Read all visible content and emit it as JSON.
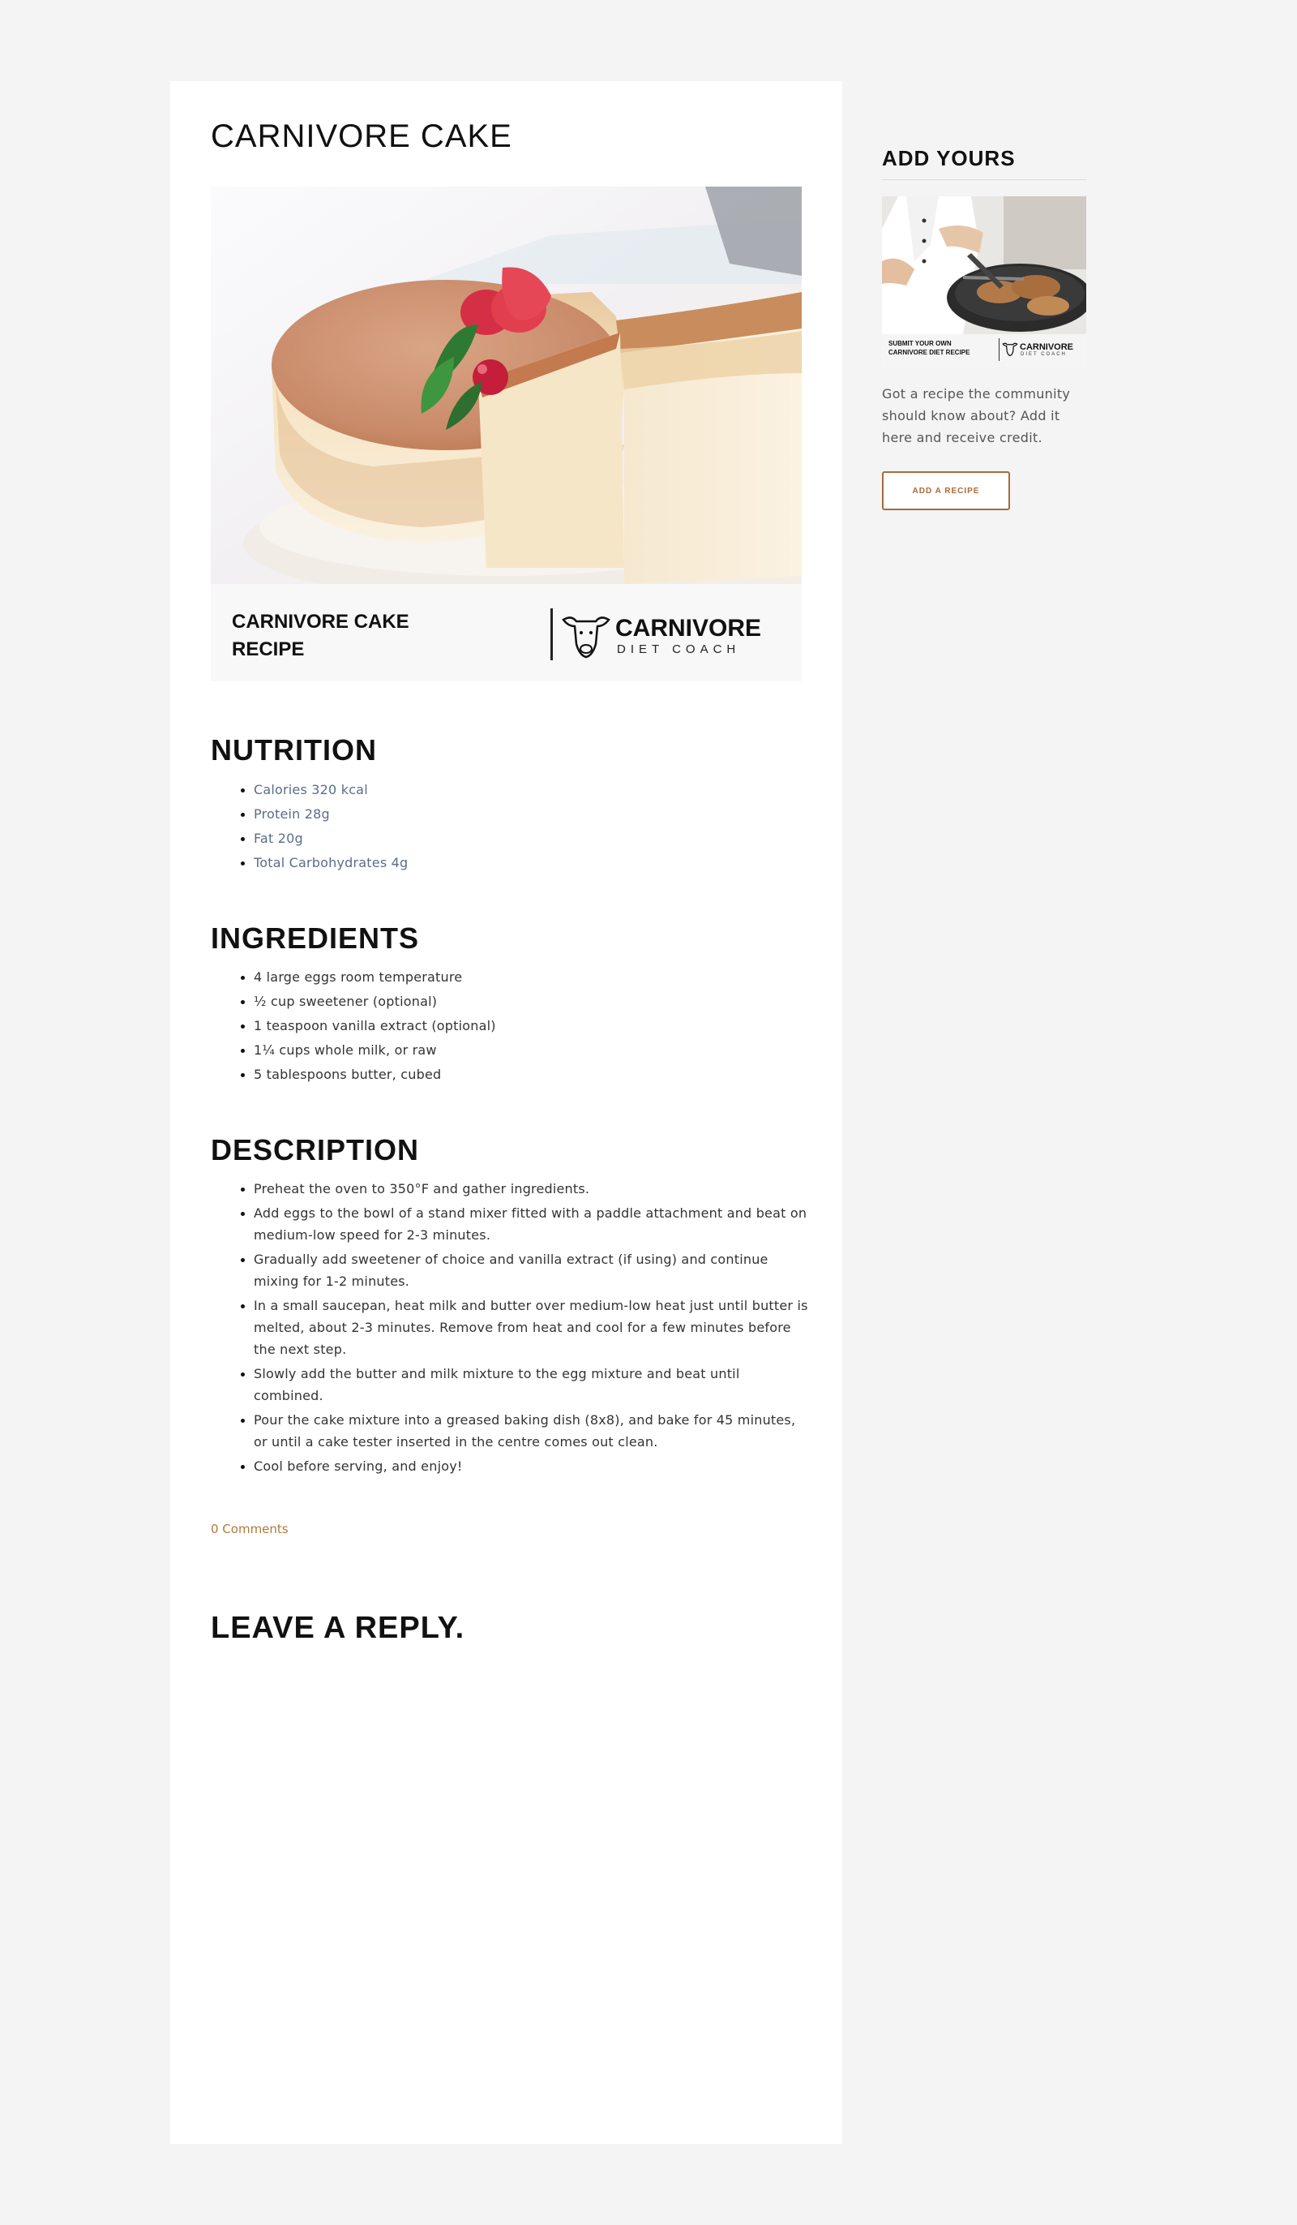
{
  "post": {
    "title": "CARNIVORE CAKE",
    "hero": {
      "caption": "CARNIVORE CAKE RECIPE",
      "brand_main": "CARNIVORE",
      "brand_sub": "DIET COACH"
    }
  },
  "nutrition": {
    "heading": "NUTRITION",
    "items": [
      "Calories 320 kcal",
      "Protein 28g",
      "Fat 20g",
      "Total Carbohydrates 4g"
    ]
  },
  "ingredients": {
    "heading": "INGREDIENTS",
    "items": [
      "4 large eggs room temperature",
      "½ cup sweetener (optional)",
      "1 teaspoon vanilla extract (optional)",
      "1¼ cups whole milk, or raw",
      "5 tablespoons butter, cubed"
    ]
  },
  "description": {
    "heading": "DESCRIPTION",
    "items": [
      "Preheat the oven to 350°F and gather ingredients.",
      "Add eggs to the bowl of a stand mixer fitted with a paddle attachment and beat on medium-low speed for 2-3 minutes.",
      "Gradually add sweetener of choice and vanilla extract (if using) and continue mixing for 1-2 minutes.",
      "In a small saucepan, heat milk and butter over medium-low heat just until butter is melted, about 2-3 minutes. Remove from heat and cool for a few minutes before the next step.",
      "Slowly add the butter and milk mixture to the egg mixture and beat until combined.",
      "Pour the cake mixture into a greased baking dish (8x8), and bake for 45 minutes, or until a cake tester inserted in the centre comes out clean.",
      "Cool before serving, and enjoy!"
    ]
  },
  "comments": {
    "link": "0 Comments"
  },
  "reply": {
    "heading": "LEAVE A REPLY."
  },
  "sidebar": {
    "heading": "ADD YOURS",
    "promo": {
      "caption_line1": "SUBMIT YOUR OWN",
      "caption_line2": "CARNIVORE DIET RECIPE",
      "brand_main": "CARNIVORE",
      "brand_sub": "DIET COACH"
    },
    "text": "Got a recipe the community should know about? Add it here and receive credit.",
    "button": "ADD A RECIPE"
  },
  "colors": {
    "page_bg": "#f4f4f4",
    "accent": "#a86b3a",
    "nutrition_text": "#5a6d8a",
    "comments_link": "#b07a3a"
  },
  "icons": [
    "cow-logo-icon"
  ]
}
